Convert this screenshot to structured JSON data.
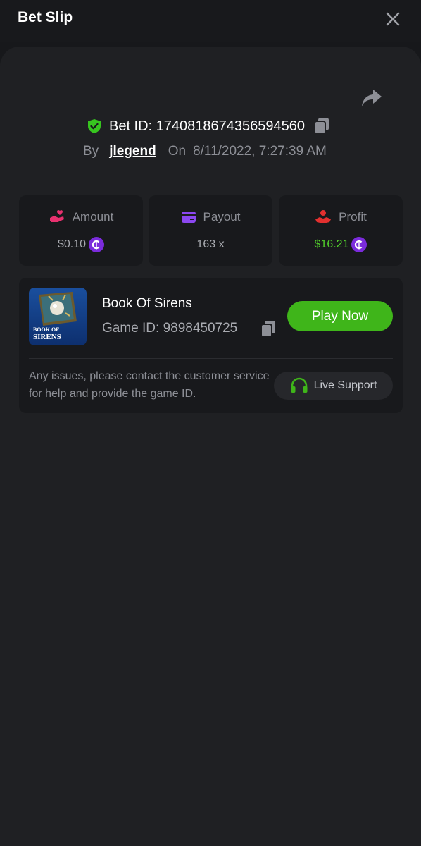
{
  "header": {
    "title": "Bet Slip",
    "close_icon": "close-icon"
  },
  "bet": {
    "share_icon": "share-icon",
    "verified_icon": "shield-check-icon",
    "bet_id_text": "Bet ID: 1740818674356594560",
    "copy_icon": "copy-icon",
    "by_label": "By",
    "username": "jlegend",
    "on_label": "On",
    "date": "8/11/2022, 7:27:39 AM"
  },
  "stats": {
    "amount": {
      "label": "Amount",
      "value": "$0.10",
      "icon": "hand-heart-icon",
      "icon_color": "#e8316f"
    },
    "payout": {
      "label": "Payout",
      "value": "163 x",
      "icon": "card-icon",
      "icon_color": "#8b47f0"
    },
    "profit": {
      "label": "Profit",
      "value": "$16.21",
      "icon": "hand-user-icon",
      "icon_color": "#e3302f",
      "value_color": "#53d22c"
    },
    "coin_icon": "coin-icon",
    "coin_color": "#7b2bdc"
  },
  "game": {
    "name": "Book Of Sirens",
    "id_text": "Game ID: 9898450725",
    "thumbnail_text_1": "BOOK OF",
    "thumbnail_text_2": "SIRENS",
    "play_label": "Play Now",
    "help_text": "Any issues, please contact the customer service for help and provide the game ID.",
    "support_label": "Live Support",
    "support_icon": "headset-icon",
    "accent_color": "#3fb51a"
  }
}
